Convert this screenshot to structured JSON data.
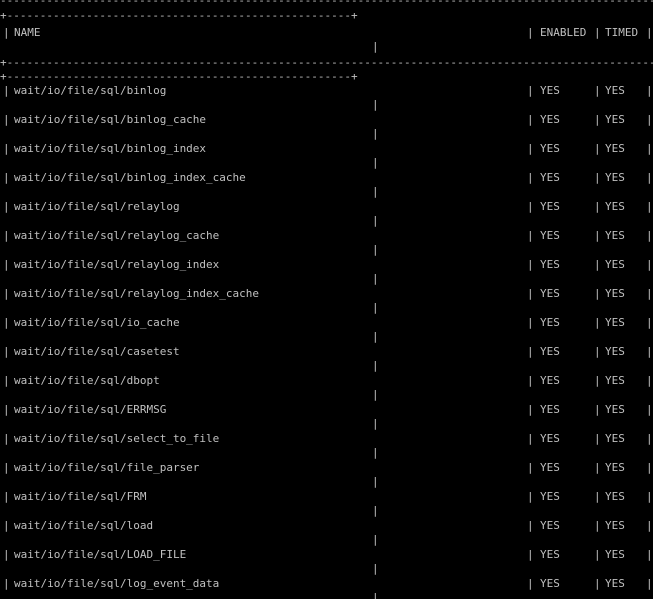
{
  "table": {
    "border_top": "+----------------------------------------------------+------------------------------------------------------------+---------+-------+",
    "border_long": "+----------------------------------------------------+",
    "border_mid": "+-------------------------------------------------------------------------------------------------------------------------------+---------+-------+",
    "pipe": "|",
    "headers": {
      "name": "NAME",
      "enabled": "ENABLED",
      "timed": "TIMED"
    },
    "rows": [
      {
        "name": "wait/io/file/sql/binlog",
        "enabled": "YES",
        "timed": "YES"
      },
      {
        "name": "wait/io/file/sql/binlog_cache",
        "enabled": "YES",
        "timed": "YES"
      },
      {
        "name": "wait/io/file/sql/binlog_index",
        "enabled": "YES",
        "timed": "YES"
      },
      {
        "name": "wait/io/file/sql/binlog_index_cache",
        "enabled": "YES",
        "timed": "YES"
      },
      {
        "name": "wait/io/file/sql/relaylog",
        "enabled": "YES",
        "timed": "YES"
      },
      {
        "name": "wait/io/file/sql/relaylog_cache",
        "enabled": "YES",
        "timed": "YES"
      },
      {
        "name": "wait/io/file/sql/relaylog_index",
        "enabled": "YES",
        "timed": "YES"
      },
      {
        "name": "wait/io/file/sql/relaylog_index_cache",
        "enabled": "YES",
        "timed": "YES"
      },
      {
        "name": "wait/io/file/sql/io_cache",
        "enabled": "YES",
        "timed": "YES"
      },
      {
        "name": "wait/io/file/sql/casetest",
        "enabled": "YES",
        "timed": "YES"
      },
      {
        "name": "wait/io/file/sql/dbopt",
        "enabled": "YES",
        "timed": "YES"
      },
      {
        "name": "wait/io/file/sql/ERRMSG",
        "enabled": "YES",
        "timed": "YES"
      },
      {
        "name": "wait/io/file/sql/select_to_file",
        "enabled": "YES",
        "timed": "YES"
      },
      {
        "name": "wait/io/file/sql/file_parser",
        "enabled": "YES",
        "timed": "YES"
      },
      {
        "name": "wait/io/file/sql/FRM",
        "enabled": "YES",
        "timed": "YES"
      },
      {
        "name": "wait/io/file/sql/load",
        "enabled": "YES",
        "timed": "YES"
      },
      {
        "name": "wait/io/file/sql/LOAD_FILE",
        "enabled": "YES",
        "timed": "YES"
      },
      {
        "name": "wait/io/file/sql/log_event_data",
        "enabled": "YES",
        "timed": "YES"
      }
    ]
  },
  "colors": {
    "background": "#000000",
    "text": "#c0c0c0"
  }
}
